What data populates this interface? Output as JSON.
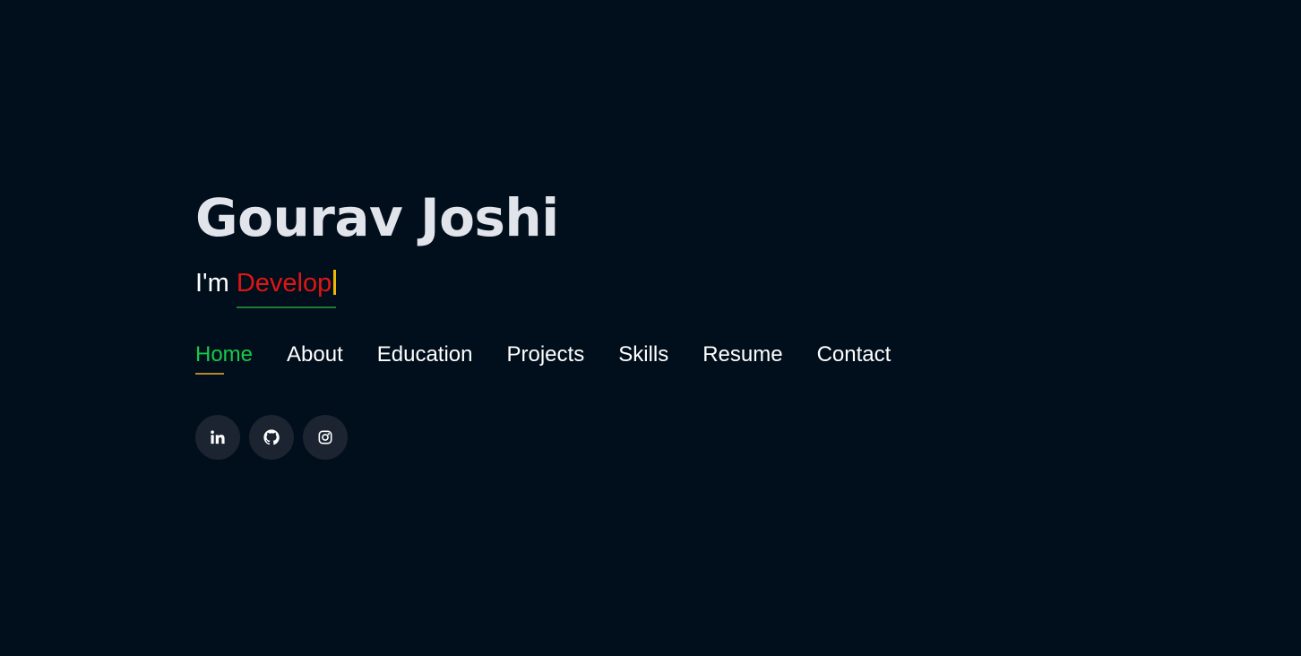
{
  "hero": {
    "name": "Gourav Joshi",
    "prefix": "I'm ",
    "typed_text": "Develop"
  },
  "nav": {
    "items": [
      {
        "label": "Home",
        "active": true
      },
      {
        "label": "About"
      },
      {
        "label": "Education"
      },
      {
        "label": "Projects"
      },
      {
        "label": "Skills"
      },
      {
        "label": "Resume"
      },
      {
        "label": "Contact"
      }
    ]
  },
  "social": {
    "icons": [
      "linkedin-icon",
      "github-icon",
      "instagram-icon"
    ]
  },
  "colors": {
    "background": "#010e1b",
    "name": "#e1e4ea",
    "typed_text": "#e01515",
    "cursor": "#f2b705",
    "typed_underline": "#1e7b3a",
    "nav_active": "#18c94a",
    "nav_active_underline": "#b8862b",
    "social_bg": "#1b2430"
  }
}
